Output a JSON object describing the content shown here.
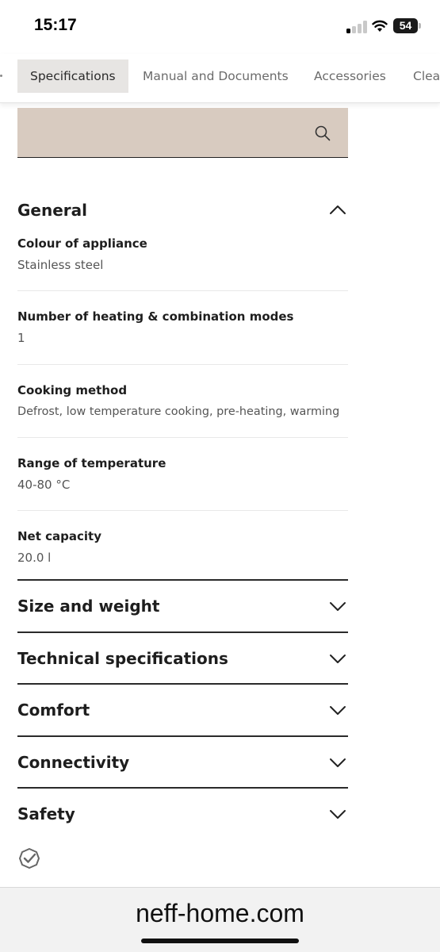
{
  "status_bar": {
    "time": "15:17",
    "battery": "54"
  },
  "tabs": [
    {
      "label": "Specifications",
      "active": true
    },
    {
      "label": "Manual and Documents",
      "active": false
    },
    {
      "label": "Accessories",
      "active": false
    },
    {
      "label": "Clea",
      "active": false
    }
  ],
  "search": {
    "placeholder": ""
  },
  "general": {
    "title": "General",
    "specs": [
      {
        "label": "Colour of appliance",
        "value": "Stainless steel"
      },
      {
        "label": "Number of heating & combination modes",
        "value": "1"
      },
      {
        "label": "Cooking method",
        "value": "Defrost, low temperature cooking, pre-heating, warming"
      },
      {
        "label": "Range of temperature",
        "value": "40-80 °C"
      },
      {
        "label": "Net capacity",
        "value": "20.0 l"
      }
    ]
  },
  "sections": [
    {
      "title": "Size and weight"
    },
    {
      "title": "Technical specifications"
    },
    {
      "title": "Comfort"
    },
    {
      "title": "Connectivity"
    },
    {
      "title": "Safety"
    }
  ],
  "browser": {
    "url": "neff-home.com"
  },
  "icons": {
    "search": "search-icon",
    "collapse": "chevron-up-icon",
    "expand": "chevron-down-icon",
    "badge": "certificate-icon"
  },
  "colors": {
    "search_bg": "#d8cbc0",
    "active_tab_bg": "#e7e5e3"
  }
}
